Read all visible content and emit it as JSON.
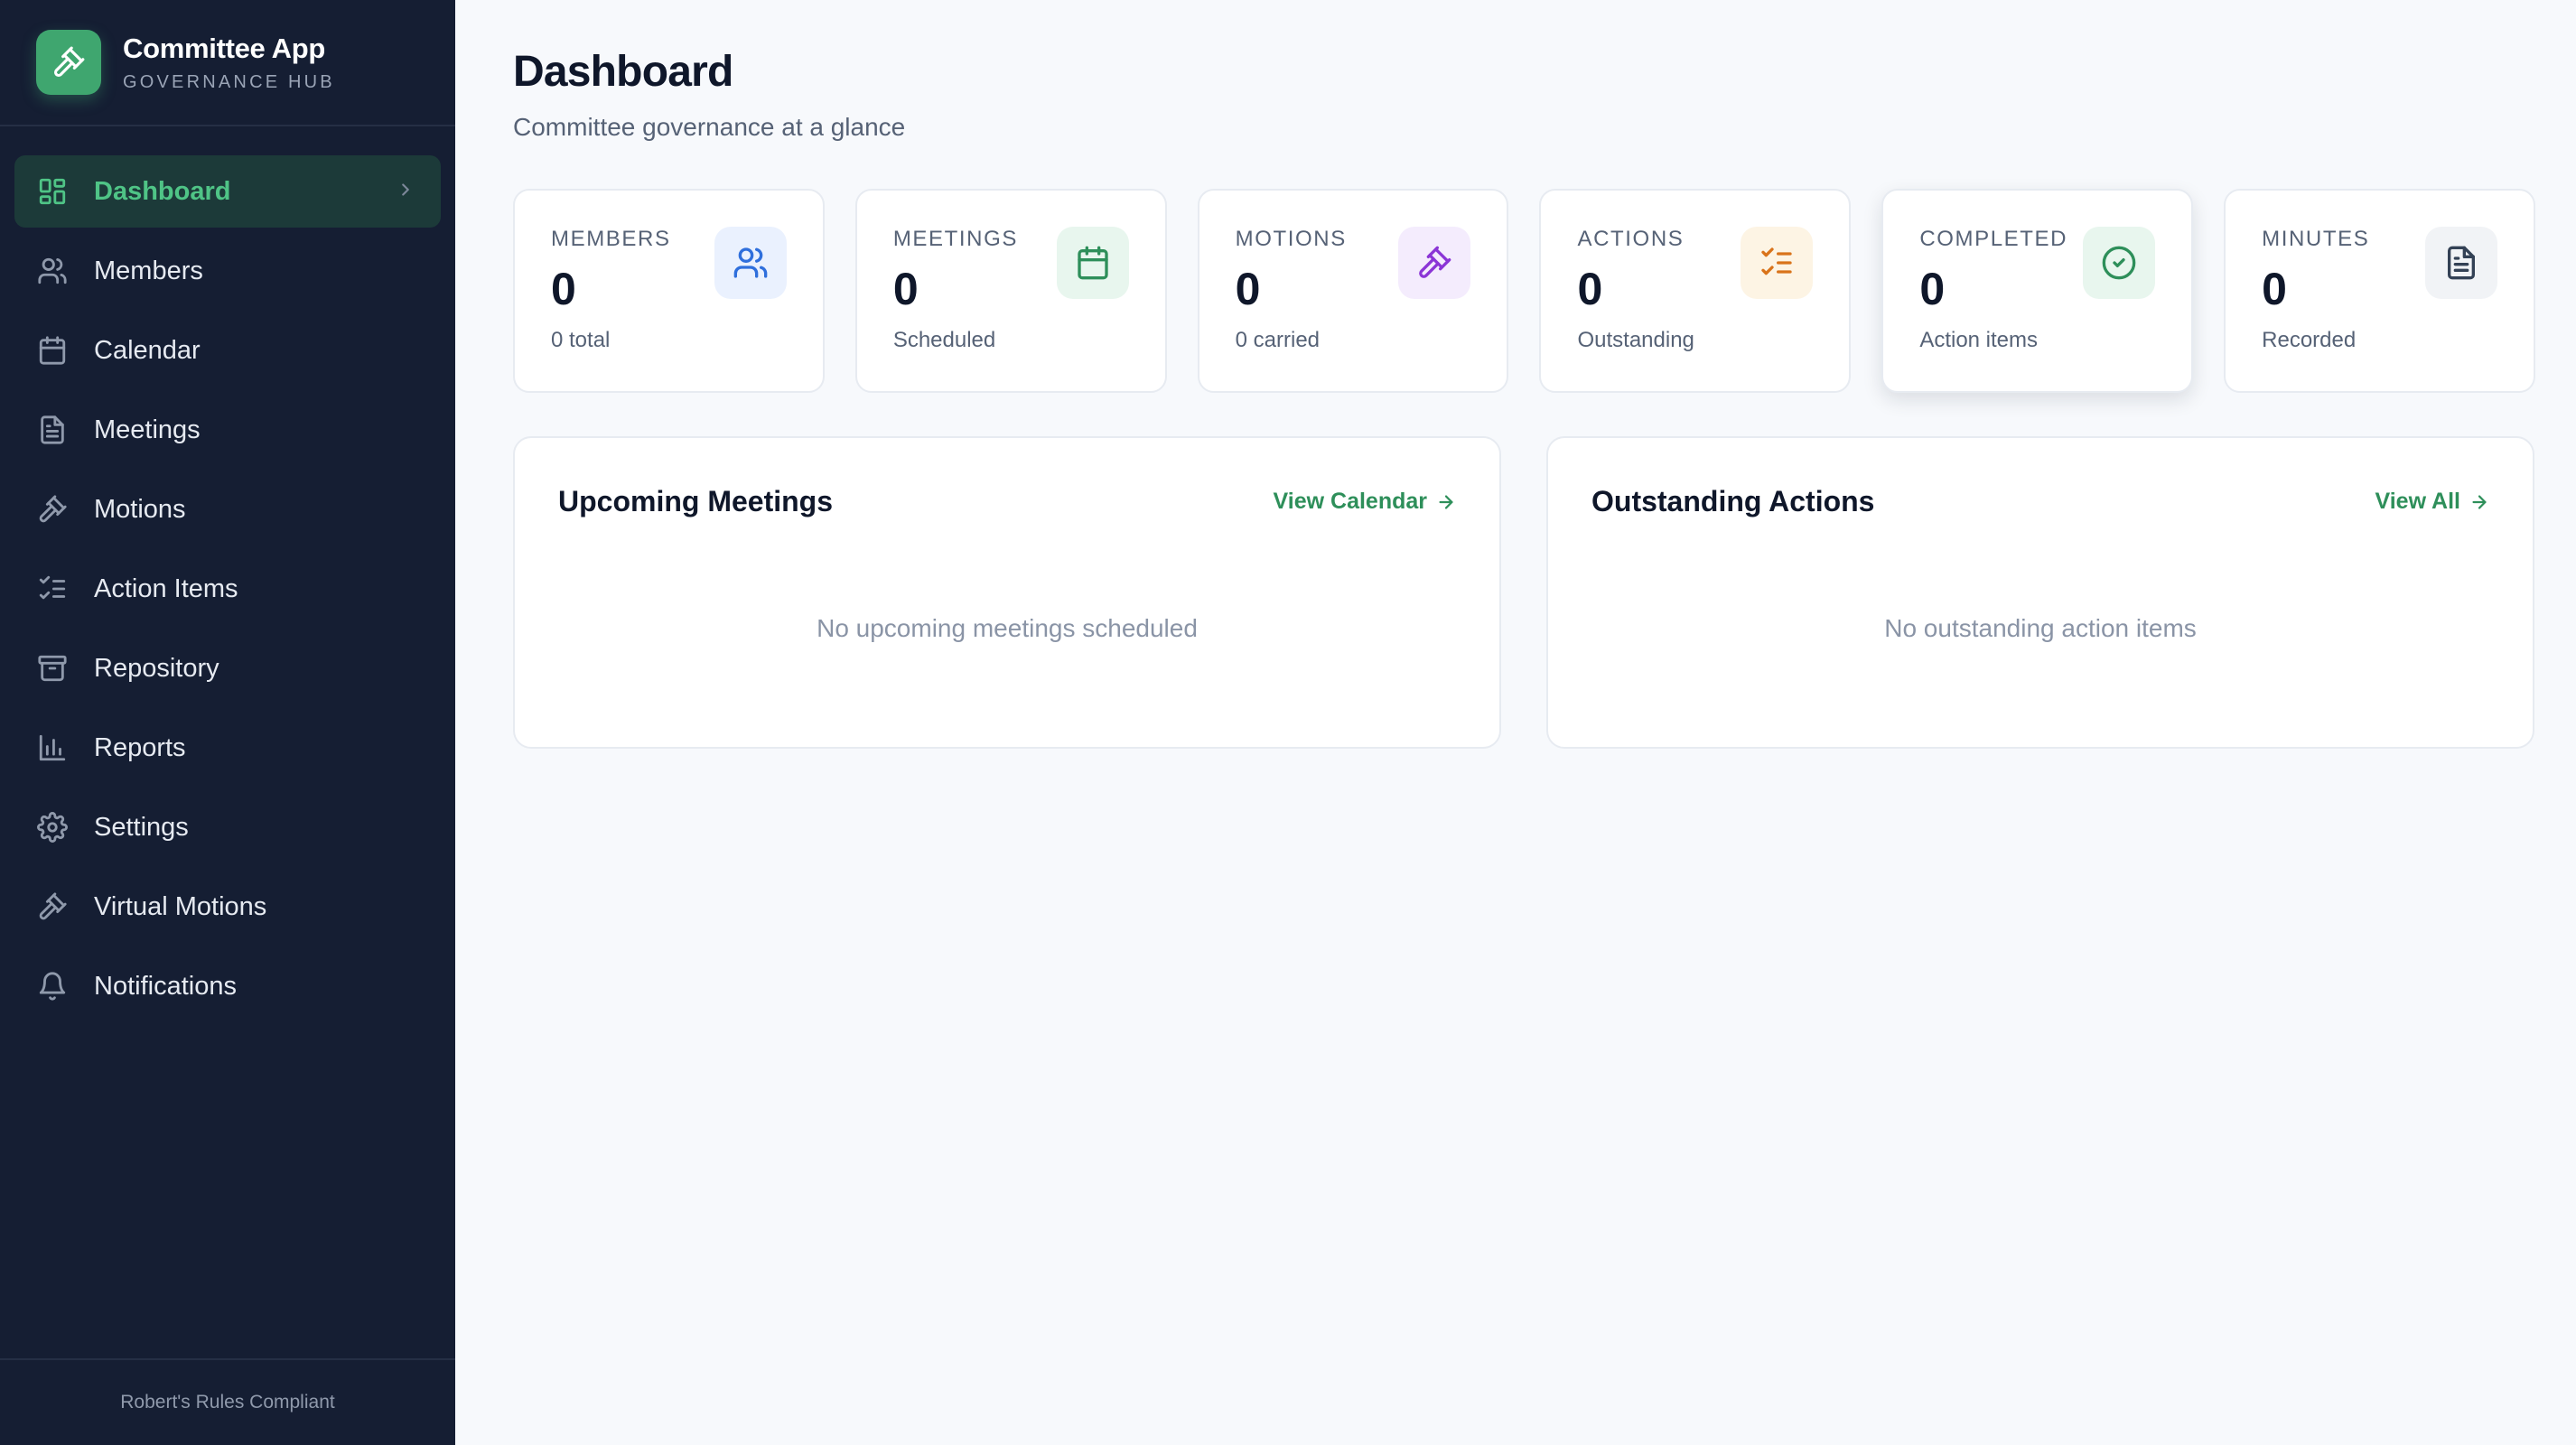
{
  "brand": {
    "title": "Committee App",
    "subtitle": "GOVERNANCE HUB",
    "accent": "#3fa66f"
  },
  "sidebar": {
    "items": [
      {
        "label": "Dashboard",
        "icon": "grid-icon",
        "active": true
      },
      {
        "label": "Members",
        "icon": "users-icon"
      },
      {
        "label": "Calendar",
        "icon": "calendar-icon"
      },
      {
        "label": "Meetings",
        "icon": "document-icon"
      },
      {
        "label": "Motions",
        "icon": "gavel-icon"
      },
      {
        "label": "Action Items",
        "icon": "checklist-icon"
      },
      {
        "label": "Repository",
        "icon": "archive-icon"
      },
      {
        "label": "Reports",
        "icon": "bar-chart-icon"
      },
      {
        "label": "Settings",
        "icon": "gear-icon"
      },
      {
        "label": "Virtual Motions",
        "icon": "gavel-icon"
      },
      {
        "label": "Notifications",
        "icon": "bell-icon"
      }
    ],
    "footer": "Robert's Rules Compliant"
  },
  "header": {
    "title": "Dashboard",
    "subtitle": "Committee governance at a glance"
  },
  "stats": [
    {
      "label": "MEMBERS",
      "value": "0",
      "note": "0 total",
      "icon": "users-icon",
      "color": "#2f6fdc",
      "bg": "#eaf1fe"
    },
    {
      "label": "MEETINGS",
      "value": "0",
      "note": "Scheduled",
      "icon": "calendar-icon",
      "color": "#2e8f5a",
      "bg": "#e8f6ee"
    },
    {
      "label": "MOTIONS",
      "value": "0",
      "note": "0 carried",
      "icon": "gavel-icon",
      "color": "#8b35d6",
      "bg": "#f4ecfd"
    },
    {
      "label": "ACTIONS",
      "value": "0",
      "note": "Outstanding",
      "icon": "checklist-icon",
      "color": "#d9731a",
      "bg": "#fdf4e4"
    },
    {
      "label": "COMPLETED",
      "value": "0",
      "note": "Action items",
      "icon": "check-circle-icon",
      "color": "#2e8f5a",
      "bg": "#e8f6ee"
    },
    {
      "label": "MINUTES",
      "value": "0",
      "note": "Recorded",
      "icon": "document-icon",
      "color": "#334155",
      "bg": "#f1f3f6"
    }
  ],
  "panels": {
    "upcoming": {
      "title": "Upcoming Meetings",
      "link": "View Calendar",
      "empty": "No upcoming meetings scheduled"
    },
    "outstanding": {
      "title": "Outstanding Actions",
      "link": "View All",
      "empty": "No outstanding action items"
    }
  }
}
